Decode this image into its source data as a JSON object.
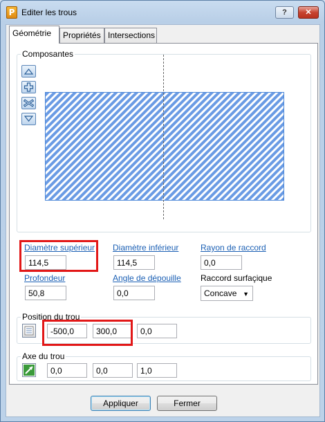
{
  "window": {
    "title": "Editer les trous",
    "app_icon_letter": "P",
    "help_label": "?",
    "close_label": "✕"
  },
  "tabs": [
    {
      "label": "Géométrie",
      "active": true
    },
    {
      "label": "Propriétés",
      "active": false
    },
    {
      "label": "Intersections",
      "active": false
    }
  ],
  "composantes": {
    "title": "Composantes",
    "side_buttons": [
      "move-up-icon",
      "add-icon",
      "delete-icon",
      "move-down-icon"
    ],
    "hatch_color": "#6a9be4"
  },
  "fields": {
    "diametre_superieur": {
      "label": "Diamètre supérieur",
      "value": "114,5"
    },
    "diametre_inferieur": {
      "label": "Diamètre inférieur",
      "value": "114,5"
    },
    "rayon_de_raccord": {
      "label": "Rayon de raccord",
      "value": "0,0"
    },
    "profondeur": {
      "label": "Profondeur",
      "value": "50,8"
    },
    "angle_de_depouille": {
      "label": "Angle de dépouille",
      "value": "0,0"
    },
    "raccord_surfacique": {
      "label": "Raccord surfaçique",
      "value": "Concave"
    }
  },
  "position": {
    "title": "Position du trou",
    "x": "-500,0",
    "y": "300,0",
    "z": "0,0"
  },
  "axe": {
    "title": "Axe du trou",
    "x": "0,0",
    "y": "0,0",
    "z": "1,0"
  },
  "buttons": {
    "apply": "Appliquer",
    "close": "Fermer"
  },
  "colors": {
    "highlight": "#e21717",
    "link": "#1a5fb4"
  }
}
